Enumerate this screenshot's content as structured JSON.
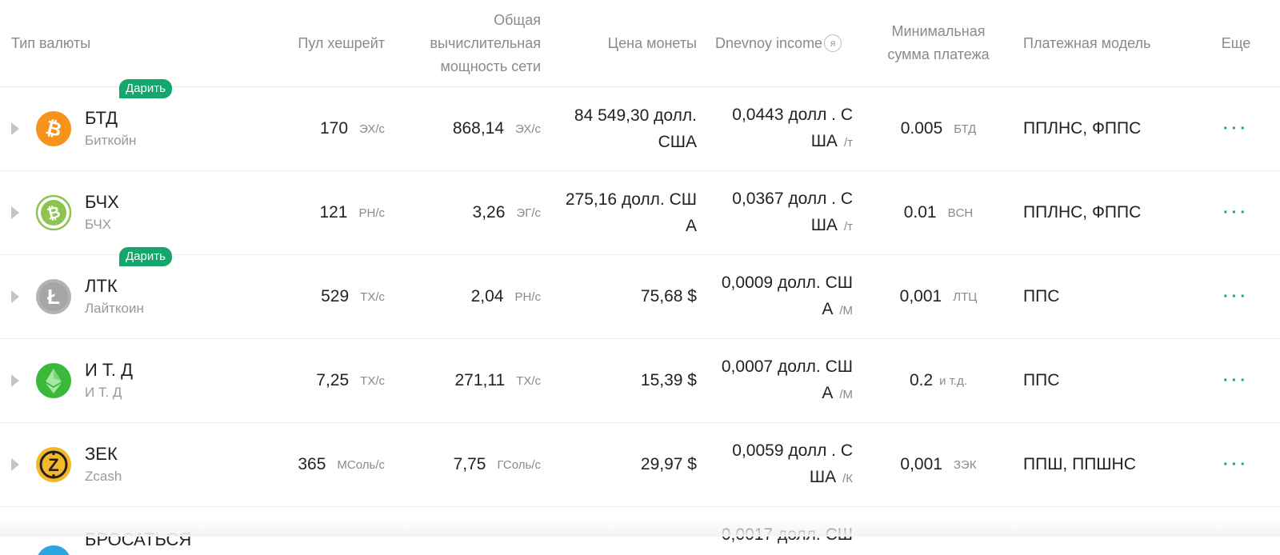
{
  "headers": {
    "currency": "Тип валюты",
    "pool_hashrate": "Пул хешрейт",
    "network_line1": "Общая",
    "network_line2": "вычислительная",
    "network_line3": "мощность сети",
    "price": "Цена монеты",
    "daily_income": "Dnevnoy income",
    "daily_icon": "я",
    "min_line1": "Минимальная",
    "min_line2": "сумма платежа",
    "payment_model": "Платежная модель",
    "more": "Еще"
  },
  "badge_label": "Дарить",
  "more_dots": "···",
  "rows": [
    {
      "symbol": "БТД",
      "name": "Биткойн",
      "icon": "bitcoin-icon",
      "icon_color": "#f7931a",
      "badge": true,
      "pool_value": "170",
      "pool_unit": "ЭХ/с",
      "net_value": "868,14",
      "net_unit": "ЭХ/с",
      "price_line1": "84 549,30 долл.",
      "price_line2": "США",
      "income_line1": "0,0443 долл . С",
      "income_line2": "ША",
      "income_unit": "/т",
      "min_value": "0.005",
      "min_unit": "БТД",
      "plan": "ППЛНС, ФППС"
    },
    {
      "symbol": "БЧХ",
      "name": "БЧХ",
      "icon": "bitcoin-cash-icon",
      "icon_color": "#8dc351",
      "badge": false,
      "pool_value": "121",
      "pool_unit": "PH/с",
      "net_value": "3,26",
      "net_unit": "ЭГ/с",
      "price_line1": "275,16 долл. СШ",
      "price_line2": "А",
      "income_line1": "0,0367 долл . С",
      "income_line2": "ША",
      "income_unit": "/т",
      "min_value": "0.01",
      "min_unit": "BCH",
      "plan": "ППЛНС, ФППС"
    },
    {
      "symbol": "ЛТК",
      "name": "Лайткоин",
      "icon": "litecoin-icon",
      "icon_color": "#a6a6a6",
      "badge": true,
      "pool_value": "529",
      "pool_unit": "TX/с",
      "net_value": "2,04",
      "net_unit": "PH/с",
      "price_line1": "75,68 $",
      "price_line2": "",
      "income_line1": "0,0009 долл. СШ",
      "income_line2": "А",
      "income_unit": "/М",
      "min_value": "0,001",
      "min_unit": "ЛТЦ",
      "plan": "ППС"
    },
    {
      "symbol": "И Т. Д",
      "name": "И Т. Д",
      "icon": "ethereum-classic-icon",
      "icon_color": "#3ab83a",
      "badge": false,
      "pool_value": "7,25",
      "pool_unit": "TX/с",
      "net_value": "271,11",
      "net_unit": "TX/с",
      "price_line1": "15,39 $",
      "price_line2": "",
      "income_line1": "0,0007 долл. СШ",
      "income_line2": "А",
      "income_unit": "/М",
      "min_value": "0.2",
      "min_unit": "и т.д.",
      "plan": "ППС"
    },
    {
      "symbol": "ЗЕК",
      "name": "Zcash",
      "icon": "zcash-icon",
      "icon_color": "#f4b728",
      "badge": false,
      "pool_value": "365",
      "pool_unit": "МСоль/с",
      "net_value": "7,75",
      "net_unit": "ГСоль/с",
      "price_line1": "29,97 $",
      "price_line2": "",
      "income_line1": "0,0059 долл . С",
      "income_line2": "ША",
      "income_unit": "/К",
      "min_value": "0,001",
      "min_unit": "ЗЭК",
      "plan": "ППШ, ППШНС"
    }
  ],
  "partial_row": {
    "symbol": "БРОСАТЬСЯ",
    "income_line1": "0,0017 долл. СШ",
    "icon": "dogecoin-icon",
    "icon_color": "#2ba4e0"
  }
}
